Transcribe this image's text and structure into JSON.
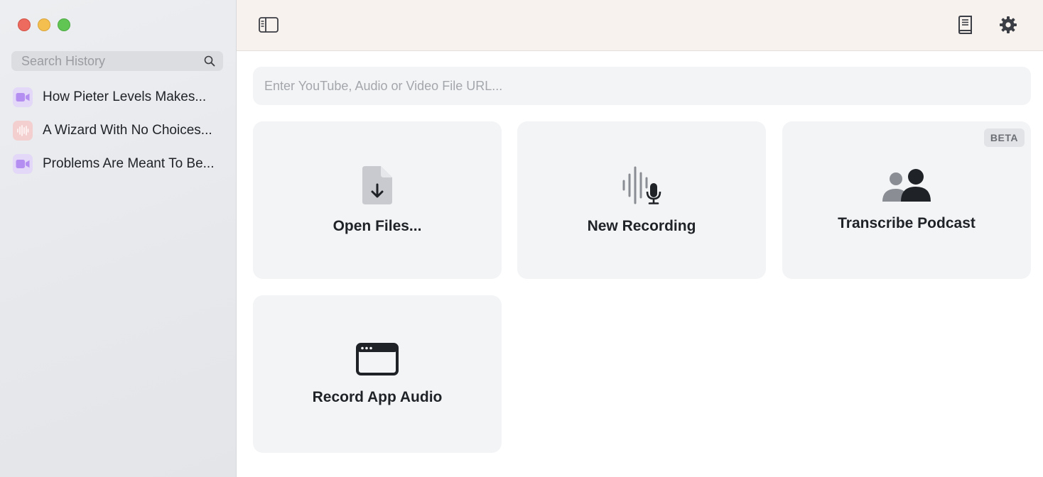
{
  "sidebar": {
    "search": {
      "placeholder": "Search History"
    },
    "history": [
      {
        "label": "How Pieter Levels Makes...",
        "type": "video"
      },
      {
        "label": "A Wizard With No Choices...",
        "type": "audio"
      },
      {
        "label": "Problems Are Meant To Be...",
        "type": "video"
      }
    ]
  },
  "toolbar": {
    "icons": [
      "sidebar-toggle-icon",
      "book-icon",
      "gear-icon"
    ]
  },
  "main": {
    "url_input": {
      "placeholder": "Enter YouTube, Audio or Video File URL..."
    },
    "cards": {
      "open_files": {
        "label": "Open Files...",
        "icon": "file-download-icon"
      },
      "new_recording": {
        "label": "New Recording",
        "icon": "waveform-microphone-icon"
      },
      "transcribe_podcast": {
        "label": "Transcribe Podcast",
        "badge": "BETA",
        "icon": "people-icon"
      },
      "record_app_audio": {
        "label": "Record App Audio",
        "icon": "app-window-icon"
      }
    }
  },
  "colors": {
    "sidebar_bg": "#e8eaed",
    "toolbar_bg": "#f8f2ee",
    "card_bg": "#f3f4f6",
    "video_icon": "#b48ef0",
    "audio_icon": "#e88a8a",
    "close": "#ec6a5e",
    "minimize": "#f4bf4f",
    "maximize": "#61c554"
  }
}
